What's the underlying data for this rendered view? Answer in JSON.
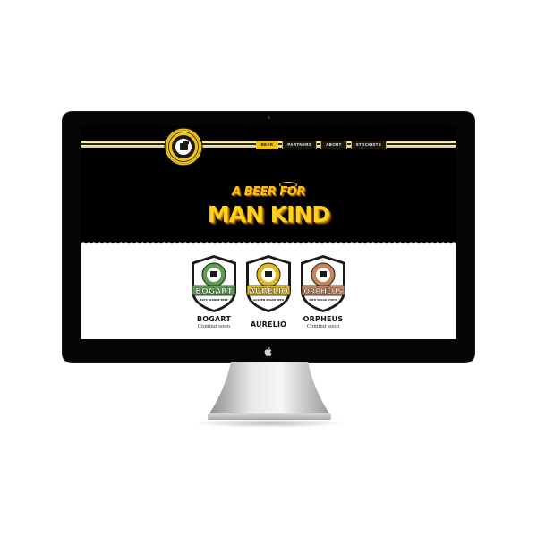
{
  "nav": {
    "items": [
      {
        "label": "BEER",
        "active": true
      },
      {
        "label": "PARTNERS",
        "active": false
      },
      {
        "label": "ABOUT",
        "active": false
      },
      {
        "label": "STOCKISTS",
        "active": false
      }
    ]
  },
  "hero": {
    "tagline_top": "A BEER FOR",
    "tagline_main": "MAN KIND"
  },
  "products": [
    {
      "badge": "BOGART",
      "sub": "BOYS BLONDE BEER",
      "name": "BOGART",
      "status": "Coming soon",
      "color": "#5aa04a"
    },
    {
      "badge": "AURELIO",
      "sub": "GOLDEN VEGAN BEER",
      "name": "AURELIO",
      "status": "",
      "color": "#e0b91e"
    },
    {
      "badge": "ORPHEUS",
      "sub": "RICH VEGAN STOUT",
      "name": "ORPHEUS",
      "status": "Coming soon",
      "color": "#c9825a"
    }
  ],
  "colors": {
    "accent": "#f0c214",
    "hero_text": "#ffd21c",
    "background": "#000000"
  },
  "icons": {
    "hardware": "apple-icon"
  }
}
